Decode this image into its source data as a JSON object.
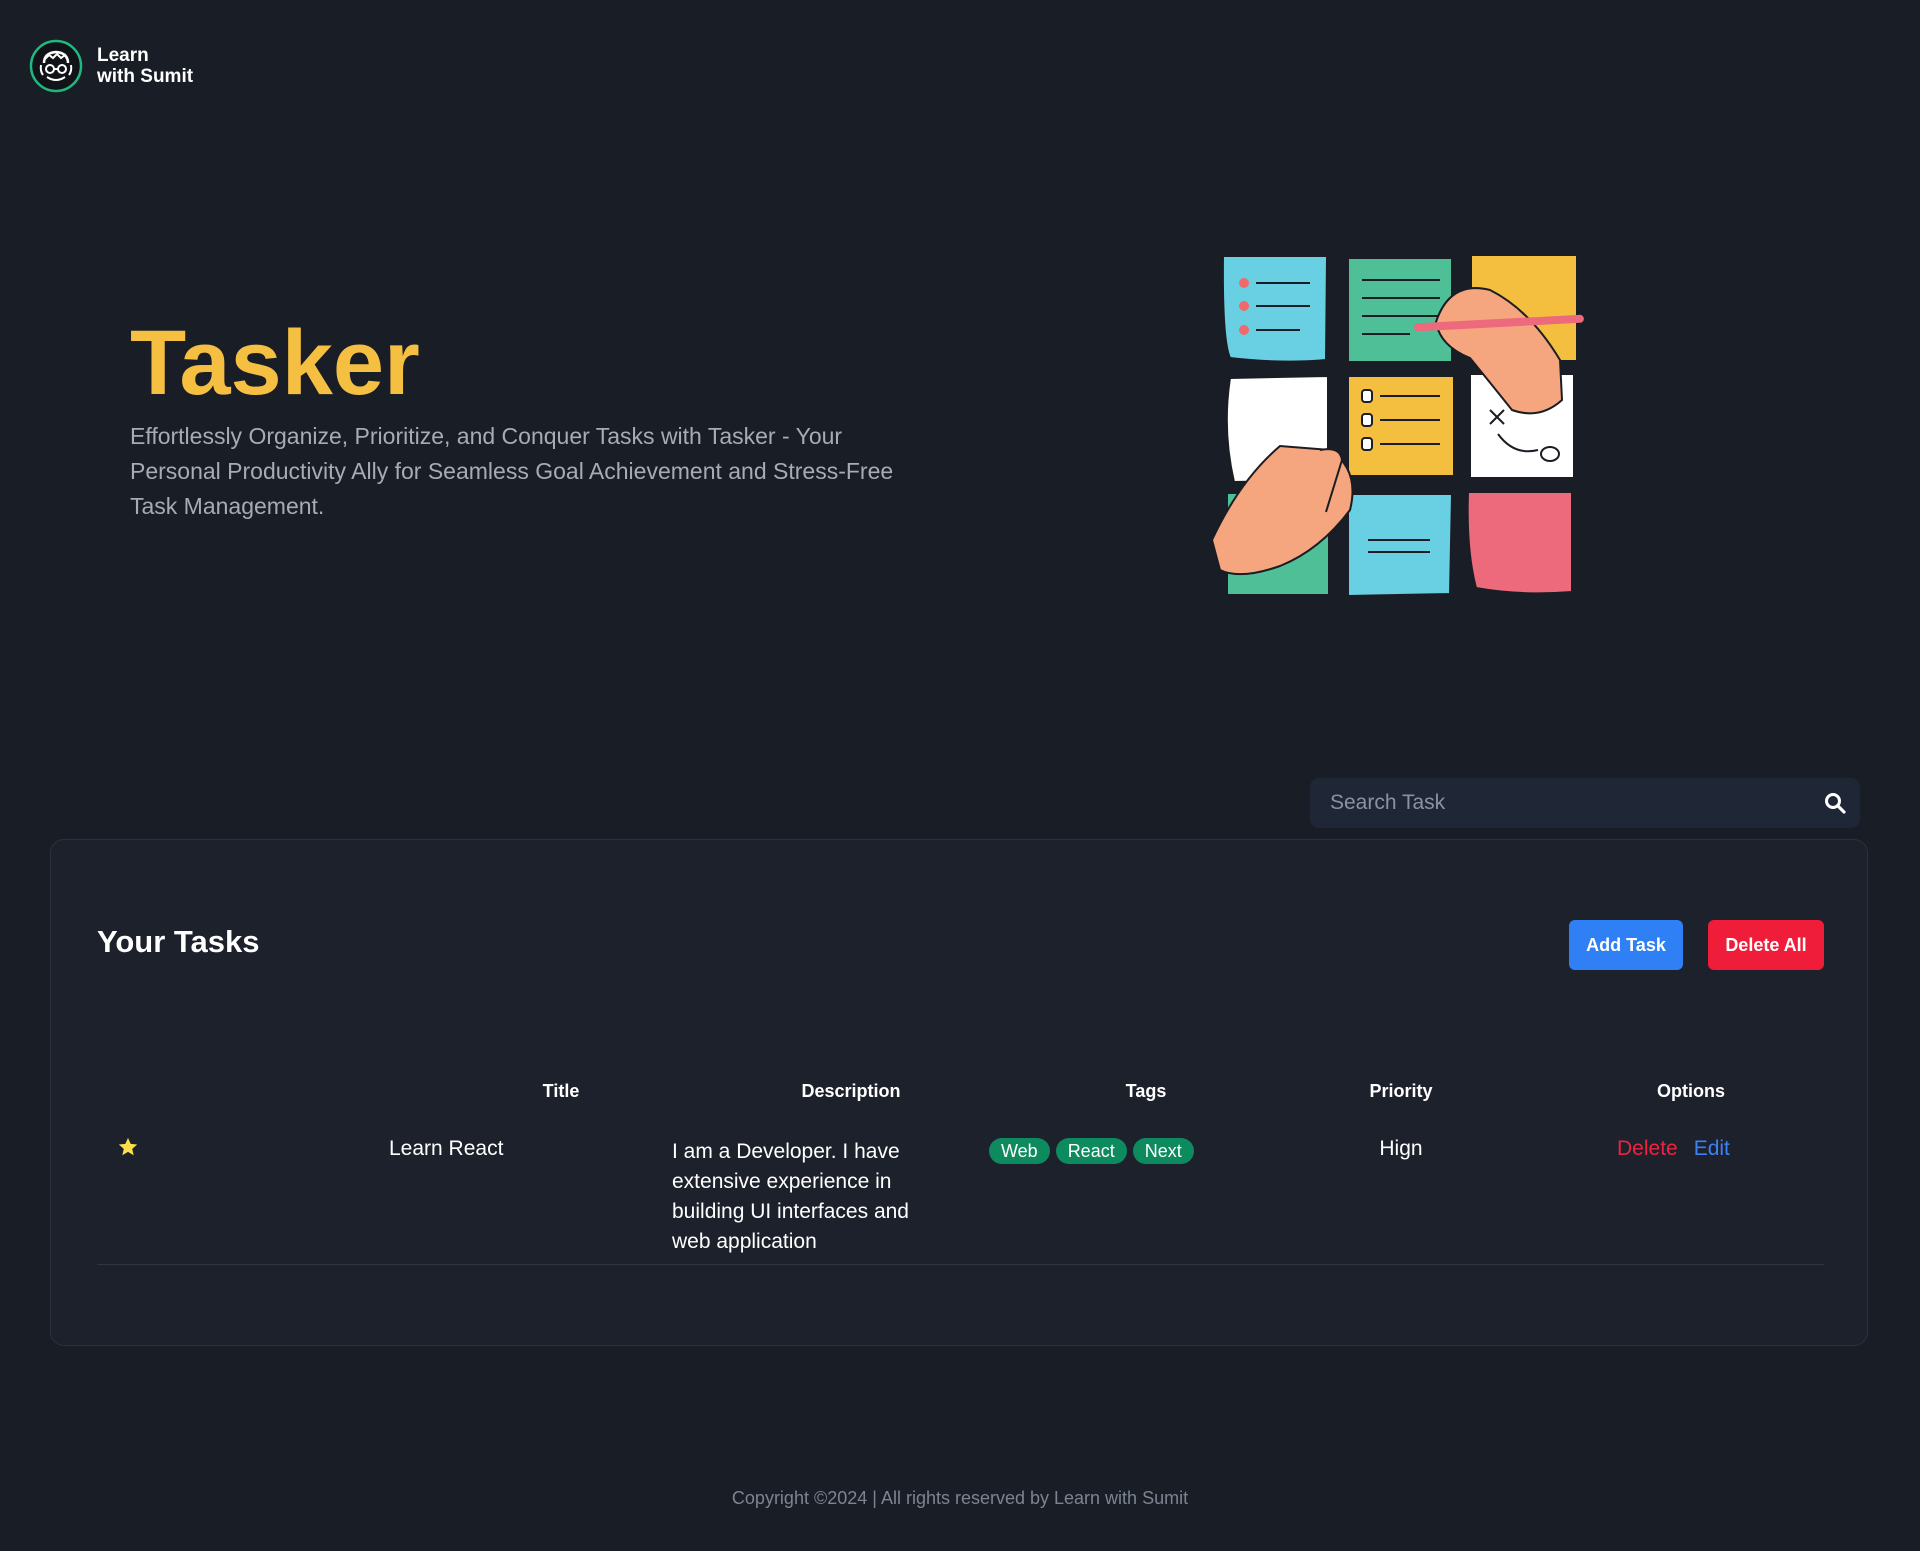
{
  "brand": {
    "name_line1": "Learn",
    "name_line2": "with Sumit"
  },
  "hero": {
    "title": "Tasker",
    "subtitle": "Effortlessly Organize, Prioritize, and Conquer Tasks with Tasker - Your Personal Productivity Ally for Seamless Goal Achievement and Stress-Free Task Management."
  },
  "search": {
    "placeholder": "Search Task",
    "value": ""
  },
  "tasks": {
    "heading": "Your Tasks",
    "add_label": "Add Task",
    "delete_all_label": "Delete All",
    "columns": {
      "title": "Title",
      "description": "Description",
      "tags": "Tags",
      "priority": "Priority",
      "options": "Options"
    },
    "rows": [
      {
        "favorite": true,
        "title": "Learn React",
        "description": "I am a Developer. I have extensive experience in building UI interfaces and web application",
        "tags": [
          "Web",
          "React",
          "Next"
        ],
        "priority": "Hign",
        "delete_label": "Delete",
        "edit_label": "Edit"
      }
    ]
  },
  "footer": {
    "text": "Copyright ©2024 | All rights reserved by Learn with Sumit"
  },
  "colors": {
    "background": "#191d26",
    "accent": "#f5bf42",
    "add_button": "#2f80f5",
    "delete_button": "#f01d3a",
    "tag": "#0e8a5f",
    "star": "#fde047"
  },
  "icons": {
    "logo": "logo-icon",
    "search": "search-icon",
    "favorite": "star-icon"
  }
}
